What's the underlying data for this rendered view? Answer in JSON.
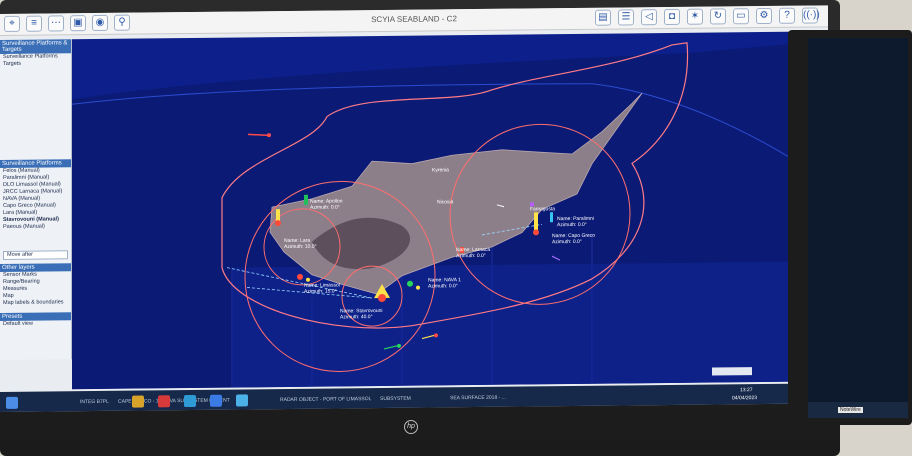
{
  "window": {
    "title": "SCYIA SEABLAND - C2"
  },
  "toolbar": {
    "left_icons": [
      "pin-icon",
      "layers-icon",
      "waypoint-icon",
      "tag-icon",
      "eye-icon",
      "search-icon"
    ],
    "right_icons": [
      "doc-icon",
      "list-icon",
      "mute-icon",
      "camera-icon",
      "compass-icon",
      "sync-icon",
      "screen-icon",
      "gear-icon",
      "help-icon",
      "radio-icon"
    ]
  },
  "sidebar": {
    "header": "Surveillance Platforms & Targets",
    "tree": [
      "Surveillance Platforms",
      "Targets"
    ],
    "platforms_header": "Surveillance Platforms",
    "platforms": [
      "Felos (Manual)",
      "Paralimni (Manual)",
      "DLO Limassol (Manual)",
      "JRCC Larnaca (Manual)",
      "NAVA (Manual)",
      "Capo Greco (Manual)",
      "Lara (Manual)",
      "Stavrovouni (Manual)",
      "Paeous (Manual)"
    ],
    "selected_platform": "Stavrovouni (Manual)",
    "move_after_label": "Move after",
    "layers_header": "Other layers",
    "layers": [
      "Sensor Marks",
      "Range/Bearing",
      "Measures",
      "Map",
      "Map labels & boundaries"
    ],
    "presets_header": "Presets",
    "presets": [
      "Default view"
    ]
  },
  "map": {
    "place_labels": [
      "Kyrenia",
      "Nicosia"
    ],
    "sensor_labels": [
      {
        "name": "Name: Lara",
        "sub": "Azimuth: 10.0°"
      },
      {
        "name": "Name: Apollon",
        "sub": "Azimuth: 0.0°"
      },
      {
        "name": "Name: Stavrovouni",
        "sub": "Azimuth: 40.0°"
      },
      {
        "name": "Name: Limassol",
        "sub": "Azimuth: 15.0°"
      },
      {
        "name": "Name: NAVA 1",
        "sub": "Azimuth: 0.0°"
      },
      {
        "name": "Name: Capo Greco",
        "sub": "Azimuth: 0.0°"
      },
      {
        "name": "Name: Larnaca",
        "sub": "Azimuth: 0.0°"
      },
      {
        "name": "Name: Paralimni",
        "sub": "Azimuth: 0.0°"
      }
    ],
    "other_labels": [
      "Famagusta"
    ]
  },
  "taskbar": {
    "time": "13:27",
    "date": "04/04/2023",
    "items": [
      "INTEG B7PL",
      "CAPE GRECO - 1 - NAVA SUBSYSTEM RECENT",
      "RADAR OBJECT - PORT OF LIMASSOL",
      "SUBSYSTEM",
      "SEA SURFACE 2018 - ...",
      "..."
    ]
  },
  "monitor": {
    "brand": "hp"
  },
  "second_monitor": {
    "taskbar_label": "NoteWire"
  },
  "colors": {
    "sea": "#0c1f8a",
    "accent": "#3a6fb7",
    "range_ring": "#ff6e6e"
  }
}
